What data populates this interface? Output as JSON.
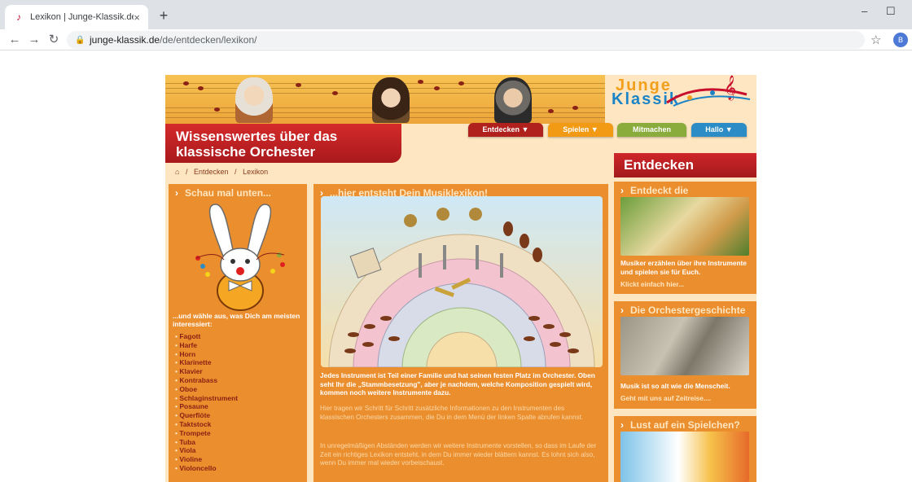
{
  "browser": {
    "tab_title": "Lexikon | Junge-Klassik.de",
    "tab_close": "×",
    "new_tab": "+",
    "url_host": "junge-klassik.de",
    "url_path": "/de/entdecken/lexikon/",
    "profile_initial": "B"
  },
  "logo": {
    "line1": "Junge",
    "line2": "Klassik"
  },
  "headline": {
    "line1": "Wissenswertes über das",
    "line2": "klassische Orchester"
  },
  "nav": [
    {
      "label": "Entdecken ▼",
      "color": "#b0201c"
    },
    {
      "label": "Spielen ▼",
      "color": "#f39a14"
    },
    {
      "label": "Mitmachen",
      "color": "#8aac3c"
    },
    {
      "label": "Hallo ▼",
      "color": "#2c8cc6"
    }
  ],
  "breadcrumb": {
    "home_icon": "home-icon",
    "sep": "/",
    "items": [
      "Entdecken",
      "Lexikon"
    ]
  },
  "left": {
    "title": "Schau mal unten...",
    "intro": "...und wähle aus, was Dich am meisten interessiert:",
    "instruments": [
      "Fagott",
      "Harfe",
      "Horn",
      "Klarinette",
      "Klavier",
      "Kontrabass",
      "Oboe",
      "Schlaginstrument",
      "Posaune",
      "Querflöte",
      "Taktstock",
      "Trompete",
      "Tuba",
      "Viola",
      "Violine",
      "Violoncello"
    ]
  },
  "main": {
    "title": "...hier entsteht Dein Musiklexikon!",
    "p1": "Jedes Instrument ist Teil einer Familie und hat seinen festen Platz im Orchester. Oben seht Ihr die „Stammbesetzung\", aber je nachdem, welche Komposition gespielt wird, kommen noch weitere Instrumente dazu.",
    "p2": "Hier tragen wir Schritt für Schritt zusätzliche Informationen zu den Instrumenten des klassischen Orchesters zusammen, die Du in dem Menü der linken Spalte abrufen kannst.",
    "p3": "In unregelmäßigen Abständen werden wir weitere Instrumente vorstellen, so dass im Laufe der Zeit ein richtiges Lexikon entsteht, in dem Du immer wieder blättern kannst. Es lohnt sich also, wenn Du immer mal wieder vorbeischaust."
  },
  "right": {
    "header": "Entdecken",
    "box1": {
      "title": "Entdeckt die Instrumente!",
      "text": "Musiker erzählen über ihre Instrumente und spielen sie für Euch.",
      "link": "Klickt einfach hier..."
    },
    "box2": {
      "title": "Die Orchestergeschichte",
      "text": "Musik ist so alt wie die Menscheit.",
      "link": "Geht mit uns auf Zeitreise...."
    },
    "box3": {
      "title": "Lust auf ein Spielchen?"
    }
  },
  "colors": {
    "orange": "#eb8e2e",
    "cream": "#fde6c1",
    "red": "#b0201c",
    "blue": "#1b84c7"
  }
}
